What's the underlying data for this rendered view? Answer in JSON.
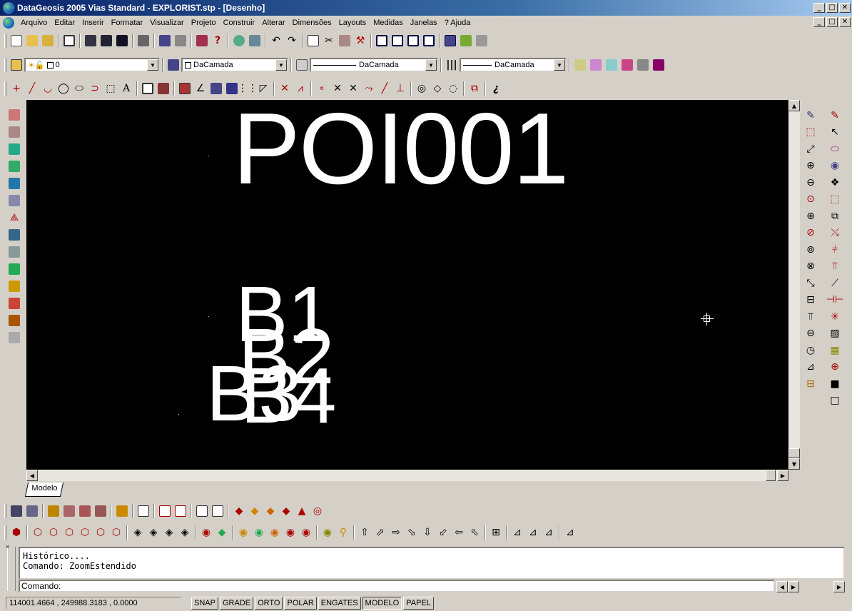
{
  "window": {
    "title": "DataGeosis 2005 Vias Standard - EXPLORIST.stp - [Desenho]",
    "min_label": "_",
    "max_label": "□",
    "close_label": "✕"
  },
  "menu": {
    "items": [
      "Arquivo",
      "Editar",
      "Inserir",
      "Formatar",
      "Visualizar",
      "Projeto",
      "Construir",
      "Alterar",
      "Dimensões",
      "Layouts",
      "Medidas",
      "Janelas",
      "? Ajuda"
    ]
  },
  "layers_toolbar": {
    "layer_value": "0",
    "color_value": "DaCamada",
    "linetype_value": "DaCamada",
    "lineweight_value": "DaCamada"
  },
  "drawing": {
    "texts": [
      "POI001",
      "B1",
      "B2",
      "B3",
      "B4"
    ]
  },
  "tabs": {
    "model": "Modelo"
  },
  "command": {
    "history_line1": "Histórico....",
    "history_line2": "Comando: ZoomEstendido",
    "prompt": "Comando:"
  },
  "status": {
    "coords": "114001.4664 , 249988.3183 , 0.0000",
    "toggles": [
      "SNAP",
      "GRADE",
      "ORTO",
      "POLAR",
      "ENGATES",
      "MODELO",
      "PAPEL"
    ]
  },
  "colors": {
    "titlebar": "#0a246a",
    "canvas_bg": "#000000",
    "canvas_text": "#ffffff",
    "chrome": "#d4d0c8"
  },
  "icons": {
    "standard_toolbar": [
      "new-icon",
      "open-icon",
      "save-icon",
      "print-icon",
      "cut-icon",
      "copy-icon",
      "paste-icon",
      "undo-icon",
      "redo-icon",
      "zoom-icon",
      "help-icon"
    ],
    "draw_toolbar": [
      "point-icon",
      "line-icon",
      "arc-icon",
      "circle-icon",
      "ellipse-icon",
      "polyline-icon",
      "rectangle-icon",
      "text-icon"
    ]
  }
}
